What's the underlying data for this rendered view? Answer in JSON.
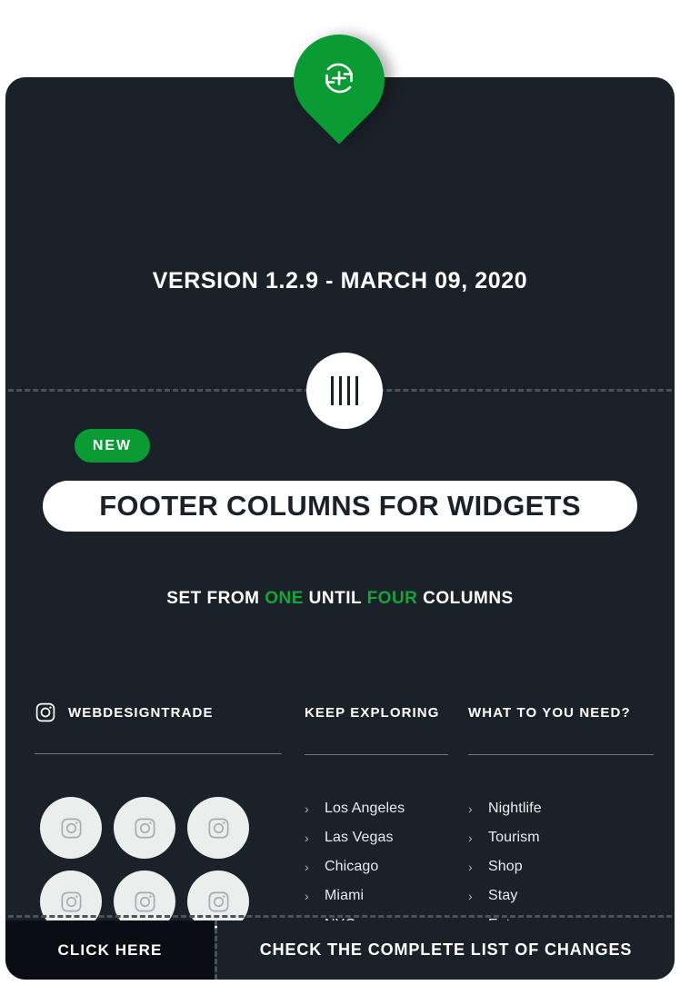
{
  "colors": {
    "card_bg": "#1b2129",
    "page_bg": "#ffffff",
    "accent_green": "#0a9b34",
    "text_green": "#17a33c",
    "bottom_left_bg": "#0a0e14",
    "social_circle_bg": "#eceded",
    "dash_line": "#4a525c"
  },
  "marker": {
    "icon": "refresh-plus-icon",
    "shape": "map-pin"
  },
  "header": {
    "version_line": "VERSION 1.2.9 - MARCH 09, 2020"
  },
  "divider_badge": {
    "icon": "four-columns-icon",
    "bars": 4
  },
  "feature": {
    "badge": "NEW",
    "title": "FOOTER COLUMNS FOR WIDGETS",
    "subtitle": {
      "part1": "SET FROM ",
      "highlight1": "ONE",
      "part2": " UNTIL ",
      "highlight2": "FOUR",
      "part3": " COLUMNS"
    }
  },
  "footer": {
    "columns": [
      {
        "icon": "instagram-icon",
        "heading": "WEBDESIGNTRADE",
        "type": "social-grid",
        "socials": [
          {
            "icon": "instagram-icon"
          },
          {
            "icon": "instagram-icon"
          },
          {
            "icon": "instagram-icon"
          },
          {
            "icon": "instagram-icon"
          },
          {
            "icon": "instagram-icon"
          },
          {
            "icon": "instagram-icon"
          }
        ]
      },
      {
        "heading": "KEEP EXPLORING",
        "type": "link-list",
        "links": [
          "Los Angeles",
          "Las Vegas",
          "Chicago",
          "Miami",
          "NYC"
        ]
      },
      {
        "heading": "WHAT TO YOU NEED?",
        "type": "link-list",
        "links": [
          "Nightlife",
          "Tourism",
          "Shop",
          "Stay",
          "Eat"
        ]
      }
    ]
  },
  "bottom_bar": {
    "left_label": "CLICK HERE",
    "right_label": "CHECK THE COMPLETE LIST OF CHANGES"
  }
}
